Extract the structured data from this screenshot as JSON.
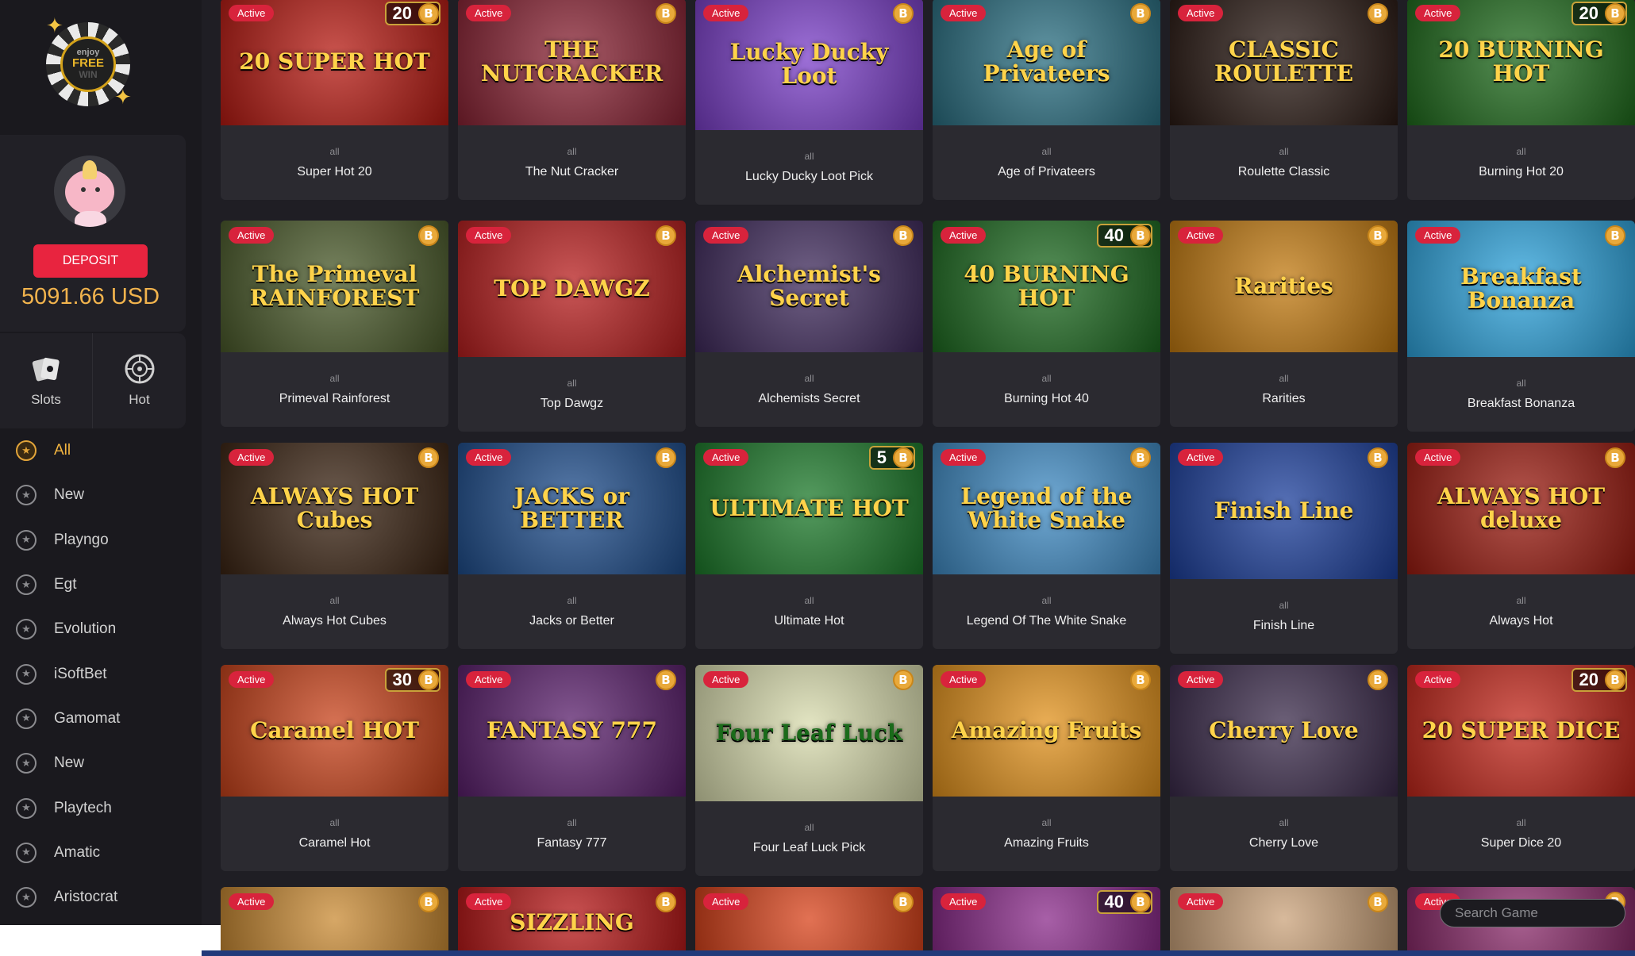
{
  "logo": {
    "line1": "enjoy",
    "line2": "FREE",
    "line3": "WIN"
  },
  "profile": {
    "deposit_label": "DEPOSIT",
    "balance": "5091.66 USD"
  },
  "categories": [
    {
      "label": "Slots",
      "icon": "cards-icon"
    },
    {
      "label": "Hot",
      "icon": "roulette-icon"
    }
  ],
  "providers": [
    "All",
    "New",
    "Playngo",
    "Egt",
    "Evolution",
    "iSoftBet",
    "Gamomat",
    "New",
    "Playtech",
    "Amatic",
    "Aristocrat"
  ],
  "active_provider": "All",
  "search": {
    "placeholder": "Search Game"
  },
  "badge_label": "Active",
  "coin_symbol": "B",
  "games": [
    {
      "name": "Super Hot 20",
      "category": "all",
      "art": "20 SUPER HOT",
      "lines": "20",
      "bg": "#b71a12"
    },
    {
      "name": "The Nut Cracker",
      "category": "all",
      "art": "THE NUTCRACKER",
      "lines": "",
      "bg": "#8a2334"
    },
    {
      "name": "Lucky Ducky Loot Pick",
      "category": "all",
      "art": "Lucky Ducky Loot",
      "lines": "",
      "bg": "#7b3fc9"
    },
    {
      "name": "Age of Privateers",
      "category": "all",
      "art": "Age of Privateers",
      "lines": "",
      "bg": "#2a6f82"
    },
    {
      "name": "Roulette Classic",
      "category": "all",
      "art": "CLASSIC ROULETTE",
      "lines": "",
      "bg": "#2a1a14"
    },
    {
      "name": "Burning Hot 20",
      "category": "all",
      "art": "20 BURNING HOT",
      "lines": "20",
      "bg": "#1f6b1c"
    },
    {
      "name": "Primeval Rainforest",
      "category": "all",
      "art": "The Primeval RAINFOREST",
      "lines": "",
      "bg": "#4a5a2a"
    },
    {
      "name": "Top Dawgz",
      "category": "all",
      "art": "TOP DAWGZ",
      "lines": "",
      "bg": "#b81e1e"
    },
    {
      "name": "Alchemists Secret",
      "category": "all",
      "art": "Alchemist's Secret",
      "lines": "",
      "bg": "#3f2a5c"
    },
    {
      "name": "Burning Hot 40",
      "category": "all",
      "art": "40 BURNING HOT",
      "lines": "40",
      "bg": "#1d6a20"
    },
    {
      "name": "Rarities",
      "category": "all",
      "art": "Rarities",
      "lines": "",
      "bg": "#c27a10"
    },
    {
      "name": "Breakfast Bonanza",
      "category": "all",
      "art": "Breakfast Bonanza",
      "lines": "",
      "bg": "#2ea4dd"
    },
    {
      "name": "Always Hot Cubes",
      "category": "all",
      "art": "ALWAYS HOT Cubes",
      "lines": "",
      "bg": "#3b2413"
    },
    {
      "name": "Jacks or Better",
      "category": "all",
      "art": "JACKS or BETTER",
      "lines": "",
      "bg": "#1e4d8c"
    },
    {
      "name": "Ultimate Hot",
      "category": "all",
      "art": "ULTIMATE HOT",
      "lines": "5",
      "bg": "#1c7a2a"
    },
    {
      "name": "Legend Of The White Snake",
      "category": "all",
      "art": "Legend of the White Snake",
      "lines": "",
      "bg": "#3f8bc4"
    },
    {
      "name": "Finish Line",
      "category": "all",
      "art": "Finish Line",
      "lines": "",
      "bg": "#1c3f9c"
    },
    {
      "name": "Always Hot",
      "category": "all",
      "art": "ALWAYS HOT deluxe",
      "lines": "",
      "bg": "#9b1b10"
    },
    {
      "name": "Caramel Hot",
      "category": "all",
      "art": "Caramel HOT",
      "lines": "30",
      "bg": "#c8421a"
    },
    {
      "name": "Fantasy 777",
      "category": "all",
      "art": "FANTASY 777",
      "lines": "",
      "bg": "#5a1f6c"
    },
    {
      "name": "Four Leaf Luck Pick",
      "category": "all",
      "art": "Four Leaf Luck",
      "lines": "",
      "bg": "#d9dcae"
    },
    {
      "name": "Amazing Fruits",
      "category": "all",
      "art": "Amazing Fruits",
      "lines": "",
      "bg": "#e2921c"
    },
    {
      "name": "Cherry Love",
      "category": "all",
      "art": "Cherry Love",
      "lines": "",
      "bg": "#3a2a4a"
    },
    {
      "name": "Super Dice 20",
      "category": "all",
      "art": "20 SUPER DICE",
      "lines": "20",
      "bg": "#c2261a"
    },
    {
      "name": "",
      "category": "",
      "art": "",
      "lines": "",
      "bg": "#c98a33"
    },
    {
      "name": "",
      "category": "",
      "art": "SIZZLING",
      "lines": "",
      "bg": "#b81818"
    },
    {
      "name": "",
      "category": "",
      "art": "",
      "lines": "",
      "bg": "#d8421a"
    },
    {
      "name": "",
      "category": "",
      "art": "",
      "lines": "40",
      "bg": "#8a2a8a"
    },
    {
      "name": "",
      "category": "",
      "art": "",
      "lines": "",
      "bg": "#caa27a"
    },
    {
      "name": "",
      "category": "",
      "art": "",
      "lines": "",
      "bg": "#8a2a6a"
    }
  ]
}
